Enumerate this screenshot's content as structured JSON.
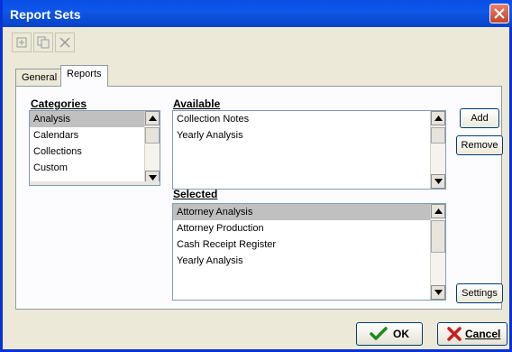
{
  "window": {
    "title": "Report Sets"
  },
  "toolbar": {
    "buttons": [
      "new-icon",
      "copy-icon",
      "delete-icon"
    ]
  },
  "tabs": [
    {
      "label": "General",
      "active": false
    },
    {
      "label": "Reports",
      "active": true
    }
  ],
  "categories": {
    "label": "Categories",
    "items": [
      "Analysis",
      "Calendars",
      "Collections",
      "Custom"
    ],
    "selected": "Analysis"
  },
  "available": {
    "label": "Available",
    "items": [
      "Collection Notes",
      "Yearly Analysis"
    ]
  },
  "selected_list": {
    "label": "Selected",
    "items": [
      "Attorney Analysis",
      "Attorney Production",
      "Cash Receipt Register",
      "Yearly Analysis"
    ],
    "highlighted": "Attorney Analysis"
  },
  "actions": {
    "add": "Add",
    "remove": "Remove",
    "settings": "Settings"
  },
  "footer": {
    "ok": "OK",
    "cancel": "Cancel"
  },
  "colors": {
    "ok_check": "#1e8a1e",
    "cancel_x": "#c81e1e",
    "title_bar": "#0a4ee6"
  }
}
